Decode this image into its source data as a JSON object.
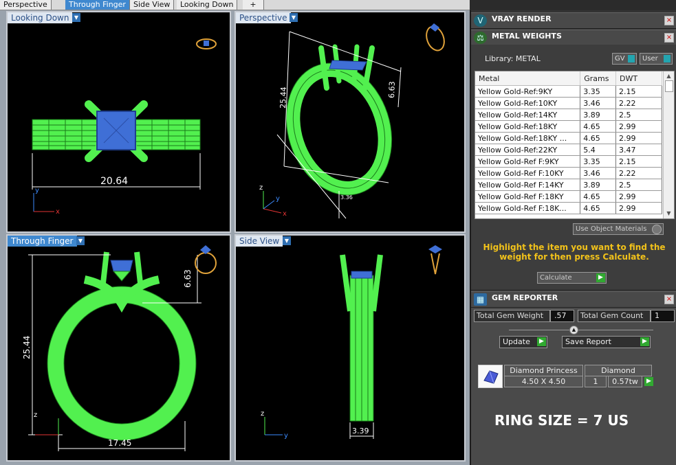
{
  "tabs": [
    "Perspective",
    "Through Finger",
    "Side View",
    "Looking Down",
    "+"
  ],
  "viewports": {
    "looking_down": {
      "label": "Looking Down",
      "dimension": "20.64"
    },
    "perspective": {
      "label": "Perspective",
      "dim_height": "25.44",
      "dim_top": "6.63",
      "dim_small": "3.36"
    },
    "through_finger": {
      "label": "Through Finger",
      "dim_height": "25.44",
      "dim_top": "6.63",
      "dim_width": "17.45"
    },
    "side_view": {
      "label": "Side View",
      "dimension": "3.39"
    }
  },
  "axes": {
    "x": "x",
    "y": "y",
    "z": "z"
  },
  "vray_render": {
    "title": "VRAY RENDER",
    "close": "×"
  },
  "metal_weights": {
    "title": "METAL WEIGHTS",
    "close": "×",
    "library_label": "Library: METAL",
    "gv_label": "GV",
    "user_label": "User",
    "columns": [
      "Metal",
      "Grams",
      "DWT"
    ],
    "rows": [
      [
        "Yellow Gold-Ref:9KY",
        "3.35",
        "2.15"
      ],
      [
        "Yellow Gold-Ref:10KY",
        "3.46",
        "2.22"
      ],
      [
        "Yellow Gold-Ref:14KY",
        "3.89",
        "2.5"
      ],
      [
        "Yellow Gold-Ref:18KY",
        "4.65",
        "2.99"
      ],
      [
        "Yellow Gold-Ref:18KY ...",
        "4.65",
        "2.99"
      ],
      [
        "Yellow Gold-Ref:22KY",
        "5.4",
        "3.47"
      ],
      [
        "Yellow Gold-Ref F:9KY",
        "3.35",
        "2.15"
      ],
      [
        "Yellow Gold-Ref F:10KY",
        "3.46",
        "2.22"
      ],
      [
        "Yellow Gold-Ref F:14KY",
        "3.89",
        "2.5"
      ],
      [
        "Yellow Gold-Ref F:18KY",
        "4.65",
        "2.99"
      ],
      [
        "Yellow Gold-Ref F:18K...",
        "4.65",
        "2.99"
      ]
    ],
    "use_object_materials": "Use Object Materials",
    "hint": "Highlight the item you want to find the weight for then press Calculate.",
    "calculate": "Calculate"
  },
  "gem_reporter": {
    "title": "GEM REPORTER",
    "close": "×",
    "total_gem_weight_label": "Total Gem Weight",
    "total_gem_weight": ".57",
    "total_gem_count_label": "Total Gem Count",
    "total_gem_count": "1",
    "update": "Update",
    "save_report": "Save Report",
    "gem_name": "Diamond Princess",
    "gem_type": "Diamond",
    "gem_size": "4.50 X 4.50",
    "gem_qty": "1",
    "gem_weight": "0.57tw"
  },
  "ring_size": "RING SIZE = 7 US",
  "colors": {
    "wire": "#52f04f",
    "stone": "#3f6fd6",
    "accent": "#3f88cf",
    "hint": "#f2c21a",
    "axis_x": "#e33434",
    "axis_y": "#3d8cff"
  }
}
